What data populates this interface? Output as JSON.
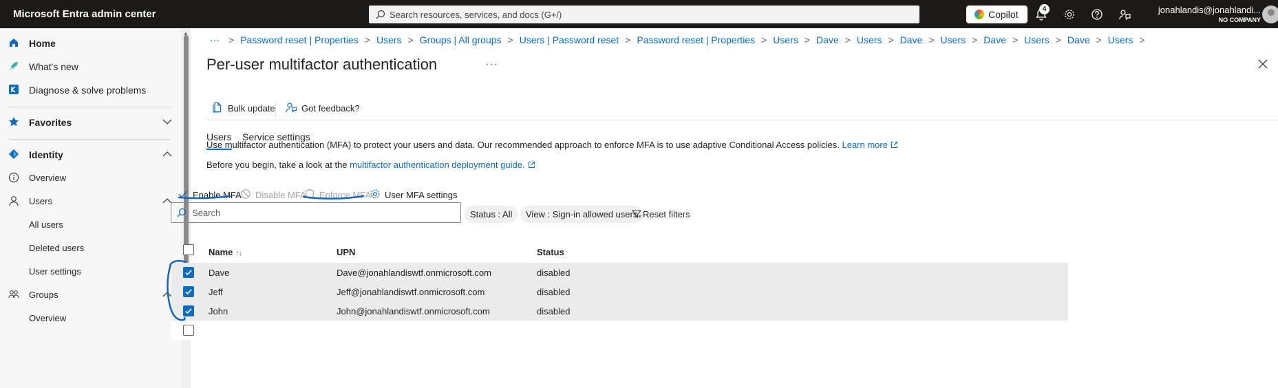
{
  "topbar": {
    "brand": "Microsoft Entra admin center",
    "search_placeholder": "Search resources, services, and docs (G+/)",
    "copilot_label": "Copilot",
    "notification_count": "4",
    "account_name": "jonahlandis@jonahlandi...",
    "account_org": "NO COMPANY"
  },
  "sidebar": {
    "items": [
      {
        "label": "Home"
      },
      {
        "label": "What's new"
      },
      {
        "label": "Diagnose & solve problems"
      },
      {
        "label": "Favorites"
      },
      {
        "label": "Identity"
      },
      {
        "label": "Overview"
      },
      {
        "label": "Users"
      },
      {
        "label": "All users"
      },
      {
        "label": "Deleted users"
      },
      {
        "label": "User settings"
      },
      {
        "label": "Groups"
      },
      {
        "label": "Overview"
      }
    ]
  },
  "breadcrumb": {
    "ellipsis": "···",
    "items": [
      "Password reset | Properties",
      "Users",
      "Groups | All groups",
      "Users | Password reset",
      "Password reset | Properties",
      "Users",
      "Dave",
      "Users",
      "Dave",
      "Users",
      "Dave",
      "Users",
      "Dave",
      "Users"
    ]
  },
  "page": {
    "title": "Per-user multifactor authentication",
    "more": "···"
  },
  "commands": {
    "bulk_update": "Bulk update",
    "feedback": "Got feedback?"
  },
  "tabs": [
    "Users",
    "Service settings"
  ],
  "description": {
    "line1": "Use multifactor authentication (MFA) to protect your users and data. Our recommended approach to enforce MFA is to use adaptive Conditional Access policies.",
    "line1_link": "Learn more",
    "line2": "Before you begin, take a look at the",
    "line2_link": "multifactor authentication deployment guide."
  },
  "actions": {
    "enable": "Enable MFA",
    "disable": "Disable MFA",
    "enforce": "Enforce MFA",
    "settings": "User MFA settings"
  },
  "filters": {
    "search_placeholder": "Search",
    "status_pill": "Status : All",
    "view_pill": "View : Sign-in allowed users",
    "reset": "Reset filters"
  },
  "table": {
    "headers": {
      "name": "Name",
      "sort": "↑↓",
      "upn": "UPN",
      "status": "Status"
    },
    "rows": [
      {
        "name": "Dave",
        "upn": "Dave@jonahlandiswtf.onmicrosoft.com",
        "status": "disabled",
        "checked": true
      },
      {
        "name": "Jeff",
        "upn": "Jeff@jonahlandiswtf.onmicrosoft.com",
        "status": "disabled",
        "checked": true
      },
      {
        "name": "John",
        "upn": "John@jonahlandiswtf.onmicrosoft.com",
        "status": "disabled",
        "checked": true
      }
    ]
  },
  "colors": {
    "accent": "#0f6cbd",
    "topbar": "#1b1a19",
    "annotation_ink": "#1565c0"
  }
}
